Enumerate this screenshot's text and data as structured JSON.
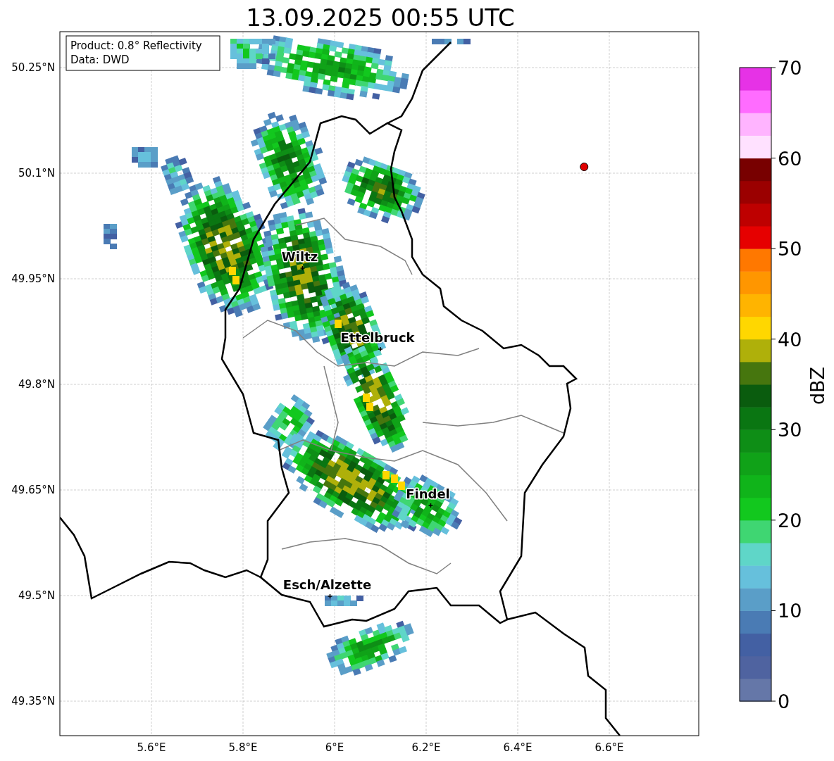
{
  "title": "13.09.2025 00:55 UTC",
  "info_box": [
    "Product: 0.8° Reflectivity",
    "Data: DWD"
  ],
  "x_ticks": [
    "5.6°E",
    "5.8°E",
    "6°E",
    "6.2°E",
    "6.4°E",
    "6.6°E"
  ],
  "y_ticks": [
    "50.25°N",
    "50.1°N",
    "49.95°N",
    "49.8°N",
    "49.65°N",
    "49.5°N",
    "49.35°N"
  ],
  "cities": [
    "Wiltz",
    "Ettelbruck",
    "Findel",
    "Esch/Alzette"
  ],
  "colorbar": {
    "label": "dBZ",
    "ticks": [
      "70",
      "60",
      "50",
      "40",
      "30",
      "20",
      "10",
      "0"
    ],
    "bins": [
      {
        "color": "#6577a8"
      },
      {
        "color": "#4f63a0"
      },
      {
        "color": "#4360a3"
      },
      {
        "color": "#4a7bb4"
      },
      {
        "color": "#5a9ec8"
      },
      {
        "color": "#66c0dc"
      },
      {
        "color": "#5fd6c8"
      },
      {
        "color": "#3fd672"
      },
      {
        "color": "#12c81e"
      },
      {
        "color": "#10b41a"
      },
      {
        "color": "#10a218"
      },
      {
        "color": "#0e8e16"
      },
      {
        "color": "#0a7612"
      },
      {
        "color": "#0a5c0e"
      },
      {
        "color": "#46760e"
      },
      {
        "color": "#afb00a"
      },
      {
        "color": "#ffd700"
      },
      {
        "color": "#ffb400"
      },
      {
        "color": "#ff9600"
      },
      {
        "color": "#ff7800"
      },
      {
        "color": "#e60000"
      },
      {
        "color": "#be0000"
      },
      {
        "color": "#9b0000"
      },
      {
        "color": "#780000"
      },
      {
        "color": "#ffe1ff"
      },
      {
        "color": "#ffb4ff"
      },
      {
        "color": "#ff6cff"
      },
      {
        "color": "#e632e6"
      }
    ]
  }
}
